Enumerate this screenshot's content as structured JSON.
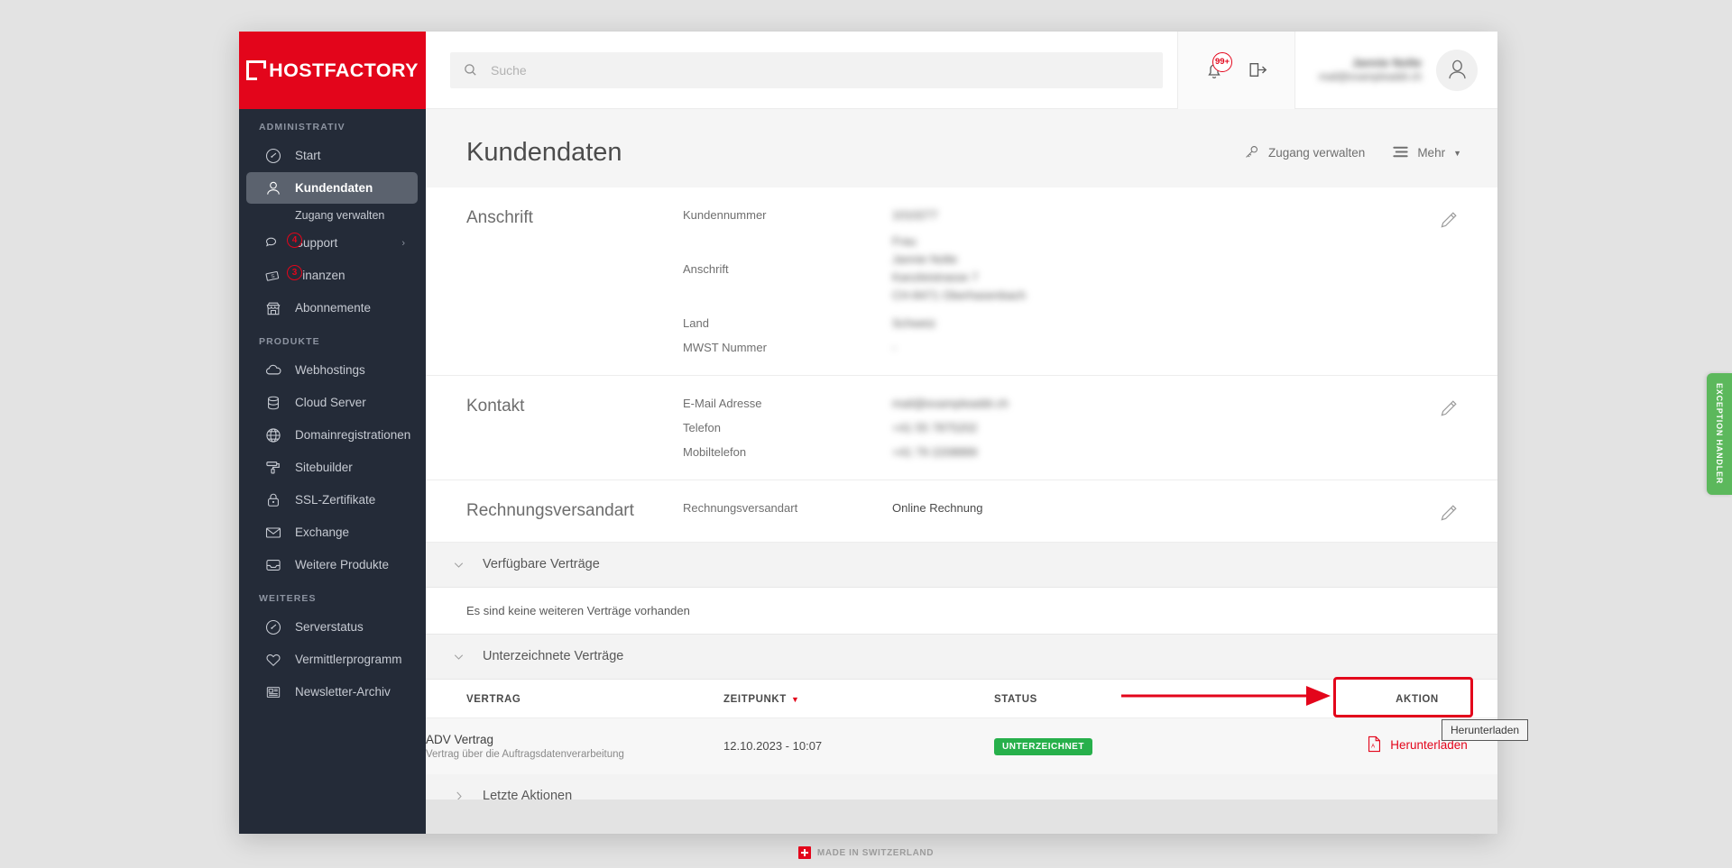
{
  "brand": {
    "name": "HOSTFACTORY",
    "red": "#e3051b",
    "sidebar_bg": "#242b38"
  },
  "sidebar": {
    "sections": [
      {
        "title": "ADMINISTRATIV",
        "items": [
          {
            "label": "Start",
            "icon": "gauge-icon",
            "badge": null,
            "active": false
          },
          {
            "label": "Kundendaten",
            "icon": "user-icon",
            "badge": null,
            "active": true
          },
          {
            "label": "Zugang verwalten",
            "icon": null,
            "sub": true
          },
          {
            "label": "Support",
            "icon": "chat-icon",
            "badge": "4",
            "chevron": true
          },
          {
            "label": "Finanzen",
            "icon": "money-icon",
            "badge": "3"
          },
          {
            "label": "Abonnemente",
            "icon": "shop-icon",
            "badge": null
          }
        ]
      },
      {
        "title": "PRODUKTE",
        "items": [
          {
            "label": "Webhostings",
            "icon": "cloud-icon"
          },
          {
            "label": "Cloud Server",
            "icon": "database-icon"
          },
          {
            "label": "Domainregistrationen",
            "icon": "globe-icon"
          },
          {
            "label": "Sitebuilder",
            "icon": "paintroller-icon"
          },
          {
            "label": "SSL-Zertifikate",
            "icon": "lock-icon"
          },
          {
            "label": "Exchange",
            "icon": "envelope-icon"
          },
          {
            "label": "Weitere Produkte",
            "icon": "inbox-icon"
          }
        ]
      },
      {
        "title": "WEITERES",
        "items": [
          {
            "label": "Serverstatus",
            "icon": "gauge-icon"
          },
          {
            "label": "Vermittlerprogramm",
            "icon": "heart-icon"
          },
          {
            "label": "Newsletter-Archiv",
            "icon": "newspaper-icon"
          }
        ]
      }
    ]
  },
  "topbar": {
    "search_placeholder": "Suche",
    "search_value": "",
    "notification_badge": "99+",
    "user_name": "Jannie Nolte",
    "user_email": "mail@exampleaddr.ch"
  },
  "page": {
    "title": "Kundendaten",
    "actions": [
      {
        "label": "Zugang verwalten",
        "icon": "key-icon"
      },
      {
        "label": "Mehr",
        "icon": "list-icon",
        "caret": true
      }
    ]
  },
  "sections": [
    {
      "label": "Anschrift",
      "fields": [
        {
          "label": "Kundennummer",
          "value": "1010277",
          "blurred": true
        },
        {
          "label": "Anschrift",
          "value": "Frau\nJannie Nolte\nKanzleistrasse 7\nCH-8471 Oberhasenbach",
          "blurred": true,
          "multiline": true
        },
        {
          "label": "Land",
          "value": "Schweiz",
          "blurred": true
        },
        {
          "label": "MWST Nummer",
          "value": "-",
          "blurred": true
        }
      ]
    },
    {
      "label": "Kontakt",
      "fields": [
        {
          "label": "E-Mail Adresse",
          "value": "mail@exampleaddr.ch",
          "blurred": true
        },
        {
          "label": "Telefon",
          "value": "+41 55 7875202",
          "blurred": true
        },
        {
          "label": "Mobiltelefon",
          "value": "+41 79 2208889",
          "blurred": true
        }
      ]
    },
    {
      "label": "Rechnungsversandart",
      "fields": [
        {
          "label": "Rechnungsversandart",
          "value": "Online Rechnung",
          "blurred": false
        }
      ]
    }
  ],
  "accordions": {
    "available_contracts": {
      "title": "Verfügbare Verträge",
      "expanded": true,
      "empty_text": "Es sind keine weiteren Verträge vorhanden"
    },
    "signed_contracts": {
      "title": "Unterzeichnete Verträge",
      "expanded": true
    },
    "last_actions": {
      "title": "Letzte Aktionen",
      "expanded": false
    }
  },
  "contracts_table": {
    "columns": [
      "VERTRAG",
      "ZEITPUNKT",
      "STATUS",
      "AKTION"
    ],
    "sorted_column": "ZEITPUNKT",
    "rows": [
      {
        "name": "ADV Vertrag",
        "subtitle": "Vertrag über die Auftragsdatenverarbeitung",
        "date": "12.10.2023 - 10:07",
        "status": "UNTERZEICHNET",
        "status_color": "#27b04b",
        "action_label": "Herunterladen",
        "action_icon": "pdf-icon"
      }
    ]
  },
  "tooltip": {
    "text": "Herunterladen"
  },
  "footer": {
    "made_in": "MADE IN SWITZERLAND"
  },
  "exception_tab": {
    "label": "EXCEPTION HANDLER",
    "color": "#5cb85c"
  }
}
